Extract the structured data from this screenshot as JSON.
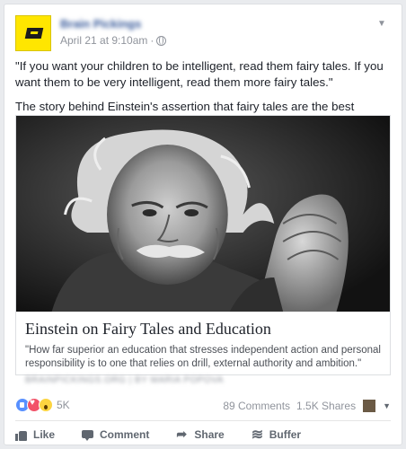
{
  "post": {
    "page_name": "Brain Pickings",
    "timestamp": "April 21 at 9:10am",
    "separator": "·",
    "text_quote": "\"If you want your children to be intelligent, read them fairy tales. If you want them to be very intelligent, read them more fairy tales.\"",
    "text_intro": "The story behind Einstein's assertion that fairy tales are the best education:"
  },
  "link_preview": {
    "title": "Einstein on Fairy Tales and Education",
    "description": "\"How far superior an education that stresses independent action and personal responsibility is to one that relies on drill, external authority and ambition.\"",
    "source": "BRAINPICKINGS.ORG | BY MARIA POPOVA"
  },
  "stats": {
    "reaction_count": "5K",
    "comments": "89 Comments",
    "shares": "1.5K Shares"
  },
  "actions": {
    "like": "Like",
    "comment": "Comment",
    "share": "Share",
    "buffer": "Buffer"
  },
  "icons": [
    "globe-icon",
    "chevron-down-icon",
    "like-reaction-icon",
    "love-reaction-icon",
    "wow-reaction-icon",
    "like-icon",
    "comment-icon",
    "share-icon",
    "buffer-icon"
  ],
  "colors": {
    "link_blue": "#365899",
    "meta_gray": "#90949c",
    "brand_yellow": "#ffe600"
  }
}
